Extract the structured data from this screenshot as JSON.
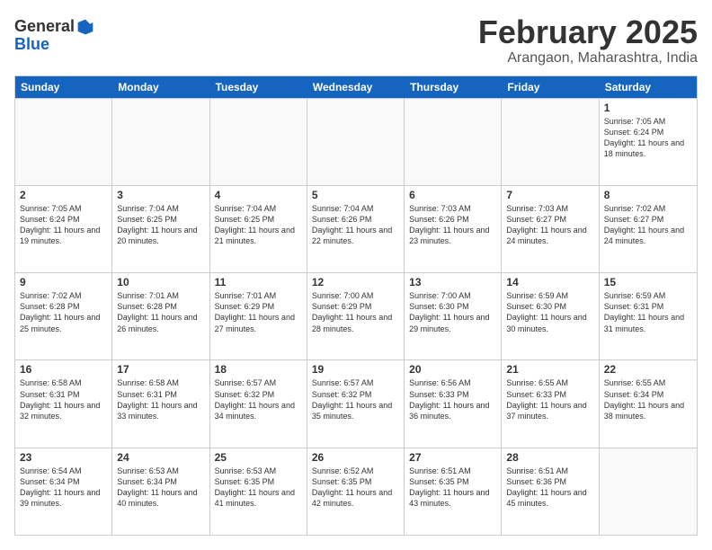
{
  "logo": {
    "general": "General",
    "blue": "Blue"
  },
  "title": "February 2025",
  "location": "Arangaon, Maharashtra, India",
  "days": [
    "Sunday",
    "Monday",
    "Tuesday",
    "Wednesday",
    "Thursday",
    "Friday",
    "Saturday"
  ],
  "rows": [
    [
      {
        "day": "",
        "text": ""
      },
      {
        "day": "",
        "text": ""
      },
      {
        "day": "",
        "text": ""
      },
      {
        "day": "",
        "text": ""
      },
      {
        "day": "",
        "text": ""
      },
      {
        "day": "",
        "text": ""
      },
      {
        "day": "1",
        "text": "Sunrise: 7:05 AM\nSunset: 6:24 PM\nDaylight: 11 hours and 18 minutes."
      }
    ],
    [
      {
        "day": "2",
        "text": "Sunrise: 7:05 AM\nSunset: 6:24 PM\nDaylight: 11 hours and 19 minutes."
      },
      {
        "day": "3",
        "text": "Sunrise: 7:04 AM\nSunset: 6:25 PM\nDaylight: 11 hours and 20 minutes."
      },
      {
        "day": "4",
        "text": "Sunrise: 7:04 AM\nSunset: 6:25 PM\nDaylight: 11 hours and 21 minutes."
      },
      {
        "day": "5",
        "text": "Sunrise: 7:04 AM\nSunset: 6:26 PM\nDaylight: 11 hours and 22 minutes."
      },
      {
        "day": "6",
        "text": "Sunrise: 7:03 AM\nSunset: 6:26 PM\nDaylight: 11 hours and 23 minutes."
      },
      {
        "day": "7",
        "text": "Sunrise: 7:03 AM\nSunset: 6:27 PM\nDaylight: 11 hours and 24 minutes."
      },
      {
        "day": "8",
        "text": "Sunrise: 7:02 AM\nSunset: 6:27 PM\nDaylight: 11 hours and 24 minutes."
      }
    ],
    [
      {
        "day": "9",
        "text": "Sunrise: 7:02 AM\nSunset: 6:28 PM\nDaylight: 11 hours and 25 minutes."
      },
      {
        "day": "10",
        "text": "Sunrise: 7:01 AM\nSunset: 6:28 PM\nDaylight: 11 hours and 26 minutes."
      },
      {
        "day": "11",
        "text": "Sunrise: 7:01 AM\nSunset: 6:29 PM\nDaylight: 11 hours and 27 minutes."
      },
      {
        "day": "12",
        "text": "Sunrise: 7:00 AM\nSunset: 6:29 PM\nDaylight: 11 hours and 28 minutes."
      },
      {
        "day": "13",
        "text": "Sunrise: 7:00 AM\nSunset: 6:30 PM\nDaylight: 11 hours and 29 minutes."
      },
      {
        "day": "14",
        "text": "Sunrise: 6:59 AM\nSunset: 6:30 PM\nDaylight: 11 hours and 30 minutes."
      },
      {
        "day": "15",
        "text": "Sunrise: 6:59 AM\nSunset: 6:31 PM\nDaylight: 11 hours and 31 minutes."
      }
    ],
    [
      {
        "day": "16",
        "text": "Sunrise: 6:58 AM\nSunset: 6:31 PM\nDaylight: 11 hours and 32 minutes."
      },
      {
        "day": "17",
        "text": "Sunrise: 6:58 AM\nSunset: 6:31 PM\nDaylight: 11 hours and 33 minutes."
      },
      {
        "day": "18",
        "text": "Sunrise: 6:57 AM\nSunset: 6:32 PM\nDaylight: 11 hours and 34 minutes."
      },
      {
        "day": "19",
        "text": "Sunrise: 6:57 AM\nSunset: 6:32 PM\nDaylight: 11 hours and 35 minutes."
      },
      {
        "day": "20",
        "text": "Sunrise: 6:56 AM\nSunset: 6:33 PM\nDaylight: 11 hours and 36 minutes."
      },
      {
        "day": "21",
        "text": "Sunrise: 6:55 AM\nSunset: 6:33 PM\nDaylight: 11 hours and 37 minutes."
      },
      {
        "day": "22",
        "text": "Sunrise: 6:55 AM\nSunset: 6:34 PM\nDaylight: 11 hours and 38 minutes."
      }
    ],
    [
      {
        "day": "23",
        "text": "Sunrise: 6:54 AM\nSunset: 6:34 PM\nDaylight: 11 hours and 39 minutes."
      },
      {
        "day": "24",
        "text": "Sunrise: 6:53 AM\nSunset: 6:34 PM\nDaylight: 11 hours and 40 minutes."
      },
      {
        "day": "25",
        "text": "Sunrise: 6:53 AM\nSunset: 6:35 PM\nDaylight: 11 hours and 41 minutes."
      },
      {
        "day": "26",
        "text": "Sunrise: 6:52 AM\nSunset: 6:35 PM\nDaylight: 11 hours and 42 minutes."
      },
      {
        "day": "27",
        "text": "Sunrise: 6:51 AM\nSunset: 6:35 PM\nDaylight: 11 hours and 43 minutes."
      },
      {
        "day": "28",
        "text": "Sunrise: 6:51 AM\nSunset: 6:36 PM\nDaylight: 11 hours and 45 minutes."
      },
      {
        "day": "",
        "text": ""
      }
    ]
  ]
}
